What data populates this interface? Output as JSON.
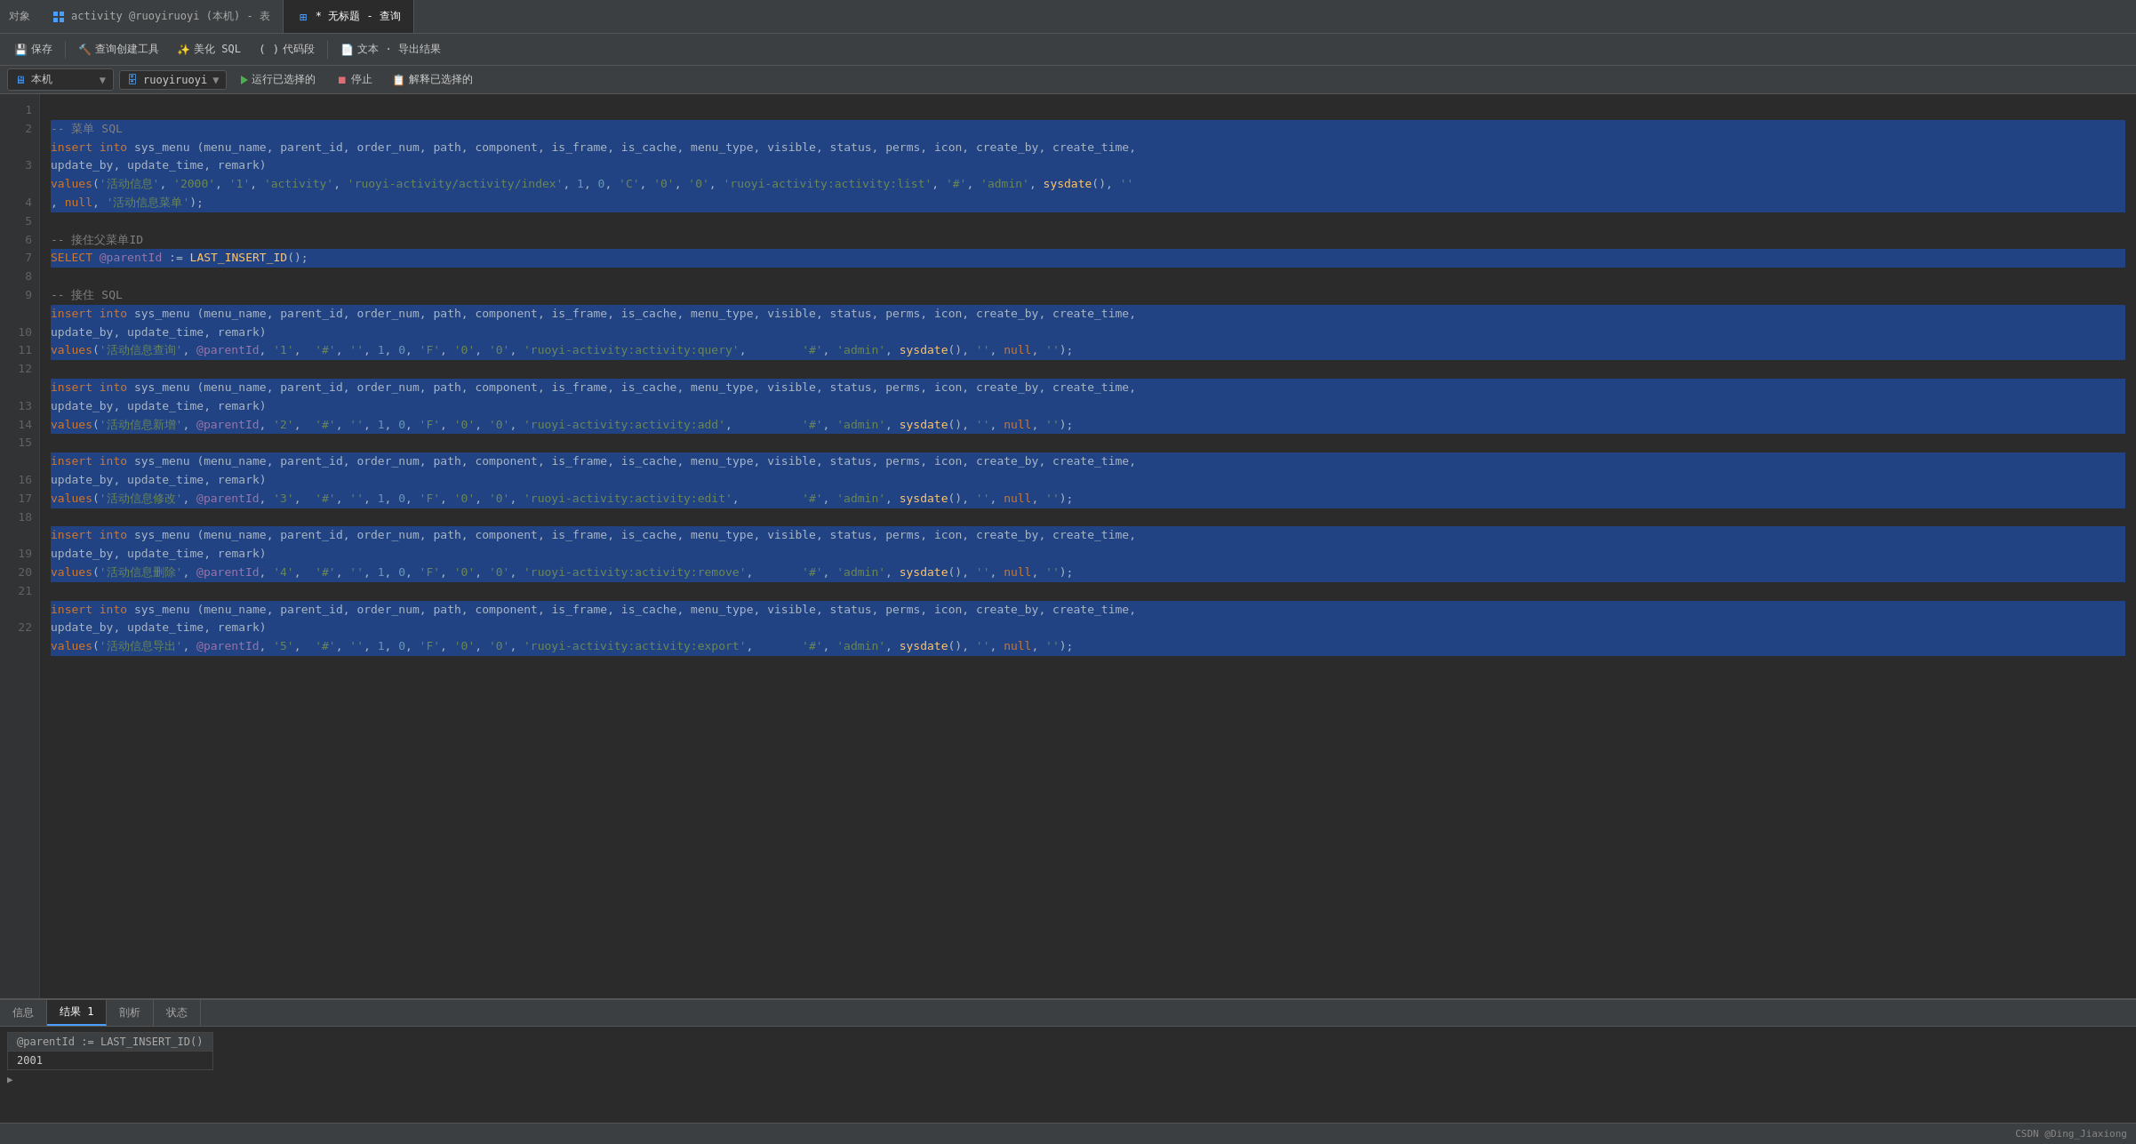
{
  "titlebar": {
    "left_label": "对象",
    "tabs": [
      {
        "id": "tab-activity",
        "label": "activity @ruoyiruoyi (本机) - 表",
        "active": false,
        "icon": "grid"
      },
      {
        "id": "tab-query",
        "label": "* 无标题 - 查询",
        "active": true,
        "icon": "query"
      }
    ]
  },
  "toolbar": {
    "buttons": [
      {
        "id": "save",
        "label": "保存",
        "icon": "💾"
      },
      {
        "id": "query-create",
        "label": "查询创建工具",
        "icon": "🔨"
      },
      {
        "id": "beautify",
        "label": "美化 SQL",
        "icon": "✨"
      },
      {
        "id": "snippet",
        "label": "代码段",
        "icon": "()"
      },
      {
        "id": "text-export",
        "label": "文本 · 导出结果",
        "icon": "📄"
      }
    ]
  },
  "connection_bar": {
    "host": "本机",
    "database": "ruoyiruoyi",
    "run_label": "运行已选择的",
    "stop_label": "停止",
    "explain_label": "解释已选择的"
  },
  "editor": {
    "comment1": "-- 菜单 SQL",
    "lines": [
      {
        "num": 1,
        "content": "",
        "selected": false
      },
      {
        "num": 2,
        "content": "insert into sys_menu (menu_name, parent_id, order_num, path, component, is_frame, is_cache, menu_type, visible, status, perms, icon, create_by, create_time,",
        "selected": true
      },
      {
        "num": 2.5,
        "content": "update_by, update_time, remark)",
        "selected": true
      },
      {
        "num": 3,
        "content": "values('活动信息', '2000', '1', 'activity', 'ruoyi-activity/activity/index', 1, 0, 'C', '0', '0', 'ruoyi-activity:activity:list', '#', 'admin', sysdate(), ''",
        "selected": true
      },
      {
        "num": 3.5,
        "content": ", null, '活动信息菜单');",
        "selected": true
      },
      {
        "num": 4,
        "content": "",
        "selected": false
      },
      {
        "num": 5,
        "content": "-- 接住父菜单ID",
        "selected": false
      },
      {
        "num": 6,
        "content": "SELECT @parentId := LAST_INSERT_ID();",
        "selected": true
      },
      {
        "num": 7,
        "content": "",
        "selected": false
      },
      {
        "num": 8,
        "content": "-- 接住 SQL",
        "selected": false
      },
      {
        "num": 9,
        "content": "insert into sys_menu (menu_name, parent_id, order_num, path, component, is_frame, is_cache, menu_type, visible, status, perms, icon, create_by, create_time,",
        "selected": true
      },
      {
        "num": 9.5,
        "content": "update_by, update_time, remark)",
        "selected": true
      },
      {
        "num": 10,
        "content": "values('活动信息查询', @parentId, '1',  '#', '', 1, 0, 'F', '0', '0', 'ruoyi-activity:activity:query',        '#', 'admin', sysdate(), '', null, '');",
        "selected": true
      },
      {
        "num": 11,
        "content": "",
        "selected": false
      },
      {
        "num": 12,
        "content": "insert into sys_menu (menu_name, parent_id, order_num, path, component, is_frame, is_cache, menu_type, visible, status, perms, icon, create_by, create_time,",
        "selected": true
      },
      {
        "num": 12.5,
        "content": "update_by, update_time, remark)",
        "selected": true
      },
      {
        "num": 13,
        "content": "values('活动信息新增', @parentId, '2',  '#', '', 1, 0, 'F', '0', '0', 'ruoyi-activity:activity:add',          '#', 'admin', sysdate(), '', null, '');",
        "selected": true
      },
      {
        "num": 14,
        "content": "",
        "selected": false
      },
      {
        "num": 15,
        "content": "insert into sys_menu (menu_name, parent_id, order_num, path, component, is_frame, is_cache, menu_type, visible, status, perms, icon, create_by, create_time,",
        "selected": true
      },
      {
        "num": 15.5,
        "content": "update_by, update_time, remark)",
        "selected": true
      },
      {
        "num": 16,
        "content": "values('活动信息修改', @parentId, '3',  '#', '', 1, 0, 'F', '0', '0', 'ruoyi-activity:activity:edit',         '#', 'admin', sysdate(), '', null, '');",
        "selected": true
      },
      {
        "num": 17,
        "content": "",
        "selected": false
      },
      {
        "num": 18,
        "content": "insert into sys_menu (menu_name, parent_id, order_num, path, component, is_frame, is_cache, menu_type, visible, status, perms, icon, create_by, create_time,",
        "selected": true
      },
      {
        "num": 18.5,
        "content": "update_by, update_time, remark)",
        "selected": true
      },
      {
        "num": 19,
        "content": "values('活动信息删除', @parentId, '4',  '#', '', 1, 0, 'F', '0', '0', 'ruoyi-activity:activity:remove',       '#', 'admin', sysdate(), '', null, '');",
        "selected": true
      },
      {
        "num": 20,
        "content": "",
        "selected": false
      },
      {
        "num": 21,
        "content": "insert into sys_menu (menu_name, parent_id, order_num, path, component, is_frame, is_cache, menu_type, visible, status, perms, icon, create_by, create_time,",
        "selected": true
      },
      {
        "num": 21.5,
        "content": "update_by, update_time, remark)",
        "selected": true
      },
      {
        "num": 22,
        "content": "values('活动信息导出', @parentId, '5',  '#', '', 1, 0, 'F', '0', '0', 'ruoyi-activity:activity:export',       '#', 'admin', sysdate(), '', null, '');",
        "selected": true
      }
    ]
  },
  "bottom_panel": {
    "tabs": [
      {
        "id": "info",
        "label": "信息"
      },
      {
        "id": "result1",
        "label": "结果 1",
        "active": true
      },
      {
        "id": "profile",
        "label": "剖析"
      },
      {
        "id": "status",
        "label": "状态"
      }
    ],
    "result_header": "@parentId := LAST_INSERT_ID()",
    "result_value": "2001"
  },
  "status_bar": {
    "text": "CSDN @Ding_Jiaxiong"
  }
}
